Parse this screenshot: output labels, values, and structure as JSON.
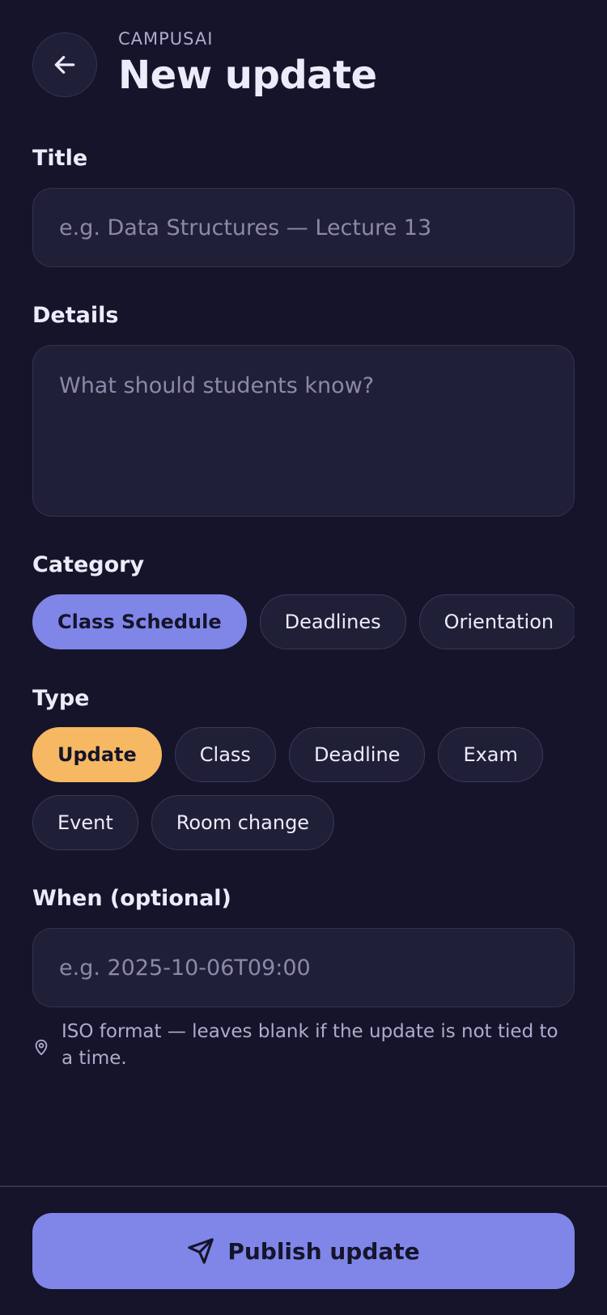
{
  "header": {
    "app_name": "CAMPUSAI",
    "title": "New update",
    "back_icon": "arrow-left-icon"
  },
  "form": {
    "title_label": "Title",
    "title_placeholder": "e.g. Data Structures — Lecture 13",
    "title_value": "",
    "details_label": "Details",
    "details_placeholder": "What should students know?",
    "details_value": "",
    "category_label": "Category",
    "categories": [
      {
        "label": "Class Schedule",
        "selected": true
      },
      {
        "label": "Deadlines",
        "selected": false
      },
      {
        "label": "Orientation",
        "selected": false
      },
      {
        "label": "",
        "selected": false
      }
    ],
    "type_label": "Type",
    "types": [
      {
        "label": "Update",
        "selected": true
      },
      {
        "label": "Class",
        "selected": false
      },
      {
        "label": "Deadline",
        "selected": false
      },
      {
        "label": "Exam",
        "selected": false
      },
      {
        "label": "Event",
        "selected": false
      },
      {
        "label": "Room change",
        "selected": false
      }
    ],
    "when_label": "When (optional)",
    "when_placeholder": "e.g. 2025-10-06T09:00",
    "when_value": "",
    "hint_icon": "map-pin-icon",
    "hint_text": "ISO format — leaves blank if the update is not tied to a time."
  },
  "footer": {
    "publish_label": "Publish update",
    "publish_icon": "send-icon"
  },
  "colors": {
    "background": "#15142a",
    "surface": "#201f38",
    "accent": "#7f86e8",
    "type_accent": "#f6b862",
    "text": "#ecebfa",
    "muted": "#aeaccd"
  }
}
